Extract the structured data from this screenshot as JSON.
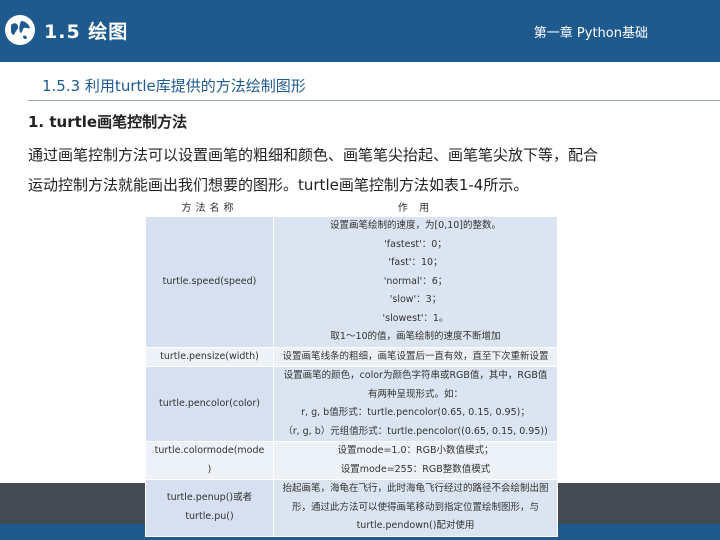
{
  "header": {
    "title": "1.5 绘图",
    "chapter": "第一章 Python基础",
    "logo_icon": "globe-icon"
  },
  "section": {
    "title": "1.5.3 利用turtle库提供的方法绘制图形"
  },
  "subheading": "1. turtle画笔控制方法",
  "paragraph": {
    "line1": "通过画笔控制方法可以设置画笔的粗细和颜色、画笔笔尖抬起、画笔笔尖放下等，配合",
    "line2": "运动控制方法就能画出我们想要的图形。turtle画笔控制方法如表1-4所示。"
  },
  "table": {
    "headers": [
      "方法名称",
      "作 用"
    ],
    "rows": [
      {
        "name_lines": [
          "turtle.speed(speed)"
        ],
        "desc_lines": [
          "设置画笔绘制的速度，为[0,10]的整数。",
          "'fastest'：0；",
          "'fast'：10；",
          "'normal'：6；",
          "'slow'：3；",
          "'slowest'：1。",
          "取1～10的值，画笔绘制的速度不断增加"
        ]
      },
      {
        "name_lines": [
          "turtle.pensize(width)"
        ],
        "desc_lines": [
          "设置画笔线条的粗细，画笔设置后一直有效，直至下次重新设置"
        ]
      },
      {
        "name_lines": [
          "turtle.pencolor(color)"
        ],
        "desc_lines": [
          "设置画笔的颜色，color为颜色字符串或RGB值，其中，RGB值",
          "有两种呈现形式。如：",
          "r, g, b值形式：turtle.pencolor(0.65, 0.15, 0.95)；",
          "（r, g, b）元组值形式：turtle.pencolor((0.65, 0.15, 0.95))"
        ]
      },
      {
        "name_lines": [
          "turtle.colormode(mode",
          ")"
        ],
        "desc_lines": [
          "设置mode=1.0：RGB小数值模式；",
          "设置mode=255：RGB整数值模式"
        ]
      },
      {
        "name_lines": [
          "turtle.penup()或者",
          "turtle.pu()"
        ],
        "desc_lines": [
          "抬起画笔，海龟在飞行，此时海龟飞行经过的路径不会绘制出图",
          "形，通过此方法可以使得画笔移动到指定位置绘制图形，与",
          "turtle.pendown()配对使用"
        ]
      }
    ]
  },
  "colors": {
    "brand_blue": "#1f5a8f",
    "table_fill": "#dbe5f1",
    "footer_band": "#444a52"
  }
}
